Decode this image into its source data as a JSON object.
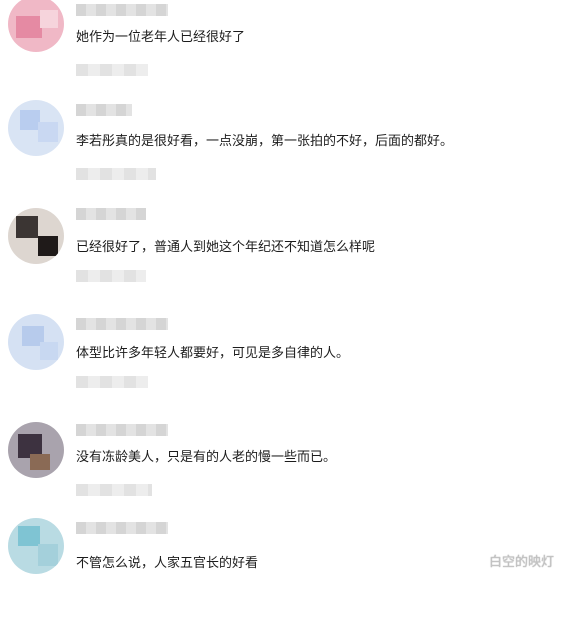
{
  "comments": [
    {
      "text": "她作为一位老年人已经很好了"
    },
    {
      "text": "李若彤真的是很好看，一点没崩，第一张拍的不好，后面的都好。"
    },
    {
      "text": "已经很好了，普通人到她这个年纪还不知道怎么样呢"
    },
    {
      "text": "体型比许多年轻人都要好，可见是多自律的人。"
    },
    {
      "text": "没有冻龄美人，只是有的人老的慢一些而已。"
    },
    {
      "text": "不管怎么说，人家五官长的好看"
    }
  ],
  "watermark": "白空的映灯",
  "colors": {
    "text": "#1c1c1c",
    "blur_light": "#e3e3e3",
    "watermark": "#c3c3c3"
  }
}
